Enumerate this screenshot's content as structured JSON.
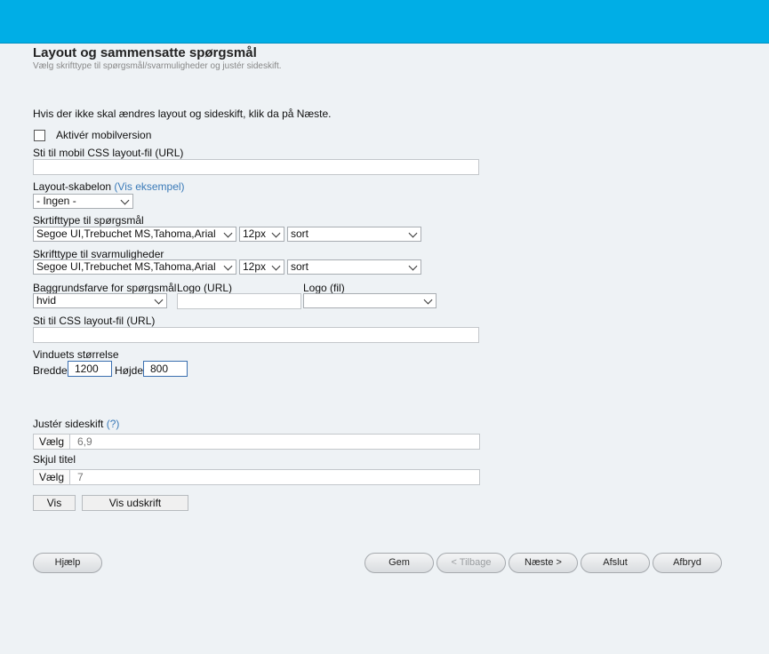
{
  "header": {
    "title": "Layout og sammensatte spørgsmål",
    "subtitle": "Vælg skrifttype til spørgsmål/svarmuligheder og justér sideskift."
  },
  "intro": "Hvis der ikke skal ændres layout og sideskift, klik da på Næste.",
  "mobile": {
    "checkbox_label": "Aktivér mobilversion",
    "checked": false,
    "css_label": "Sti til mobil CSS layout-fil (URL)",
    "css_value": ""
  },
  "template": {
    "label": "Layout-skabelon",
    "link": "(Vis eksempel)",
    "value": "- Ingen -"
  },
  "question_font": {
    "label": "Skrtifttype til spørgsmål",
    "family": "Segoe UI,Trebuchet MS,Tahoma,Arial",
    "size": "12px",
    "color": "sort"
  },
  "answer_font": {
    "label": "Skrifttype til svarmuligheder",
    "family": "Segoe UI,Trebuchet MS,Tahoma,Arial",
    "size": "12px",
    "color": "sort"
  },
  "background": {
    "label": "Baggrundsfarve for spørgsmål",
    "value": "hvid"
  },
  "logo_url": {
    "label": "Logo (URL)",
    "value": ""
  },
  "logo_file": {
    "label": "Logo (fil)",
    "value": ""
  },
  "css_file": {
    "label": "Sti til CSS layout-fil (URL)",
    "value": ""
  },
  "window": {
    "label": "Vinduets størrelse",
    "width_label": "Bredde",
    "width_value": "1200",
    "height_label": "Højde",
    "height_value": "800"
  },
  "page_break": {
    "label": "Justér sideskift",
    "help": "(?)",
    "button": "Vælg",
    "value": "6,9"
  },
  "hide_title": {
    "label": "Skjul titel",
    "button": "Vælg",
    "value": "7"
  },
  "actions": {
    "show": "Vis",
    "print": "Vis udskrift"
  },
  "footer": {
    "help": "Hjælp",
    "save": "Gem",
    "back": "< Tilbage",
    "next": "Næste >",
    "finish": "Afslut",
    "cancel": "Afbryd"
  },
  "colors": {
    "topbar": "#00aee6",
    "background": "#eef2f5",
    "link": "#3a7ab8"
  }
}
